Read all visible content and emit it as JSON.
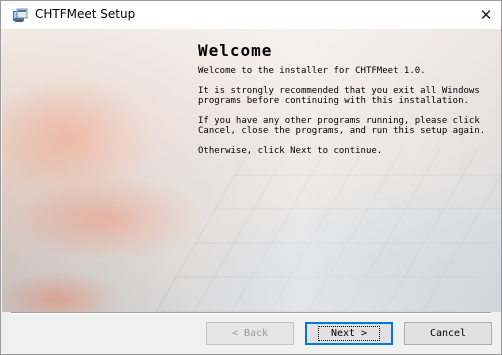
{
  "window": {
    "title": "CHTFMeet Setup",
    "close_glyph": "✕"
  },
  "welcome": {
    "heading": "Welcome",
    "paragraphs": [
      "Welcome to the installer for CHTFMeet 1.0.",
      "It is strongly recommended that you exit all Windows programs before continuing with this installation.",
      "If you have any other programs running, please click Cancel, close the programs, and run this setup again.",
      "Otherwise, click Next to continue."
    ]
  },
  "buttons": {
    "back": "< Back",
    "next": "Next >",
    "cancel": "Cancel"
  },
  "colors": {
    "focus_border": "#0078d7",
    "button_face": "#e1e1e1",
    "disabled_text": "#9a9a9a"
  }
}
